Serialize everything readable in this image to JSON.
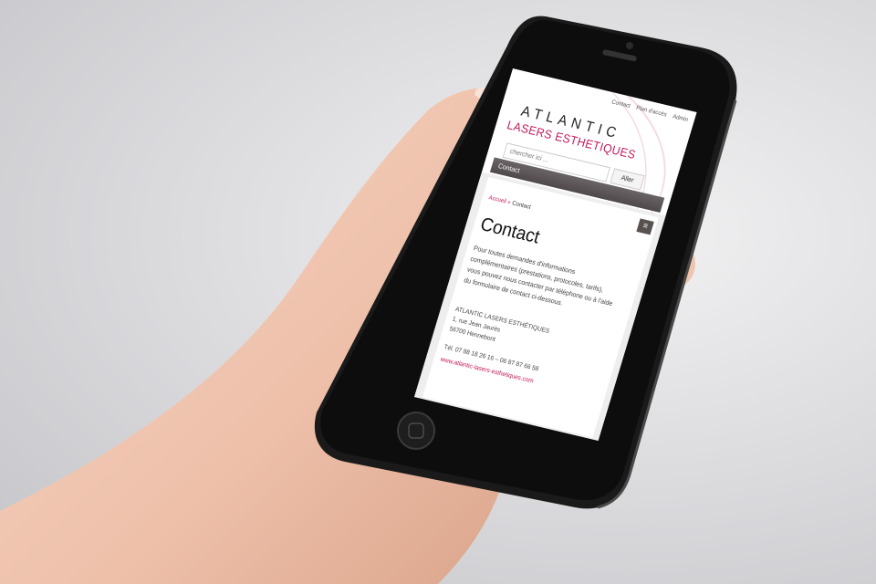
{
  "top_nav": {
    "items": [
      "Contact",
      "Plan d'accès",
      "Admin"
    ]
  },
  "brand": {
    "line1": "ATLANTIC",
    "line2": "LASERS ESTHETIQUES"
  },
  "search": {
    "placeholder": "chercher ici ...",
    "button_label": "Aller"
  },
  "nav_bar": {
    "current": "Contact",
    "menu_icon": "hamburger-menu-icon"
  },
  "breadcrumb": {
    "home": "Accueil",
    "separator": "»",
    "current": "Contact"
  },
  "page": {
    "title": "Contact",
    "intro": "Pour toutes demandes d'informations complémentaires (prestations, protocoles, tarifs), vous pouvez nous contacter par téléphone ou à l'aide du formulaire de contact ci-dessous.",
    "address": {
      "name": "ATLANTIC LASERS ESTHÉTIQUES",
      "street": "1, rue Jean Jaurès",
      "city": "56700 Hennebont"
    },
    "phone": "Tél. 07 88 18 26 16 – 06 87 87 66 58",
    "website": "www.atlantic-lasers-esthetiques.com"
  },
  "colors": {
    "accent": "#c2185b",
    "navbar": "#57514f",
    "phone_body": "#1a1a1a"
  }
}
